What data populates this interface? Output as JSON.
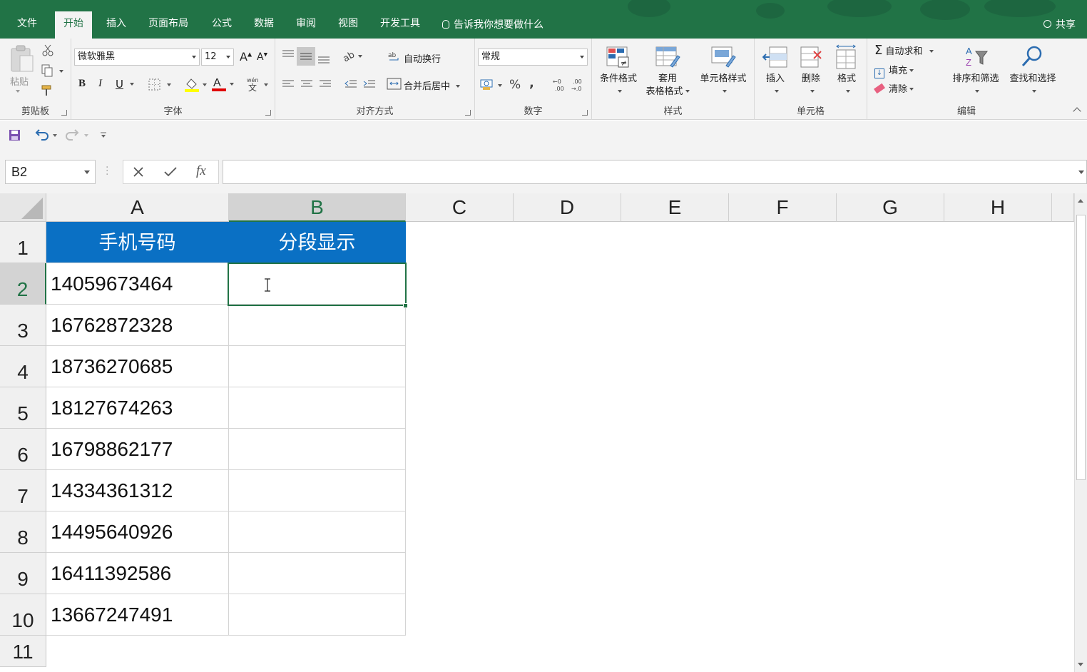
{
  "ribbon_tabs": [
    "文件",
    "开始",
    "插入",
    "页面布局",
    "公式",
    "数据",
    "审阅",
    "视图",
    "开发工具"
  ],
  "active_tab": "开始",
  "tell_me": "告诉我你想要做什么",
  "share": "共享",
  "clipboard": {
    "paste": "粘贴",
    "label": "剪贴板"
  },
  "font": {
    "name": "微软雅黑",
    "size": "12",
    "bold": "B",
    "italic": "I",
    "underline": "U",
    "label": "字体"
  },
  "alignment": {
    "wrap_text": "自动换行",
    "merge_center": "合并后居中",
    "label": "对齐方式"
  },
  "number": {
    "format": "常规",
    "percent": "%",
    "comma": ",",
    "label": "数字"
  },
  "styles": {
    "conditional": "条件格式",
    "table_format_1": "套用",
    "table_format_2": "表格格式",
    "cell_styles": "单元格样式",
    "label": "样式"
  },
  "cells": {
    "insert": "插入",
    "delete": "删除",
    "format": "格式",
    "label": "单元格"
  },
  "editing": {
    "autosum": "自动求和",
    "fill": "填充",
    "clear": "清除",
    "sort_filter": "排序和筛选",
    "find_select": "查找和选择",
    "label": "编辑"
  },
  "formula_bar": {
    "name_box": "B2",
    "fx": "fx",
    "value": ""
  },
  "columns": [
    "A",
    "B",
    "C",
    "D",
    "E",
    "F",
    "G",
    "H"
  ],
  "rows": [
    "1",
    "2",
    "3",
    "4",
    "5",
    "6",
    "7",
    "8",
    "9",
    "10",
    "11"
  ],
  "selected_cell": "B2",
  "header_row": {
    "a": "手机号码",
    "b": "分段显示"
  },
  "phone_numbers": [
    "14059673464",
    "16762872328",
    "18736270685",
    "18127674263",
    "16798862177",
    "14334361312",
    "14495640926",
    "16411392586",
    "13667247491"
  ],
  "colors": {
    "excel_green": "#217346",
    "header_blue": "#0a70c4"
  }
}
